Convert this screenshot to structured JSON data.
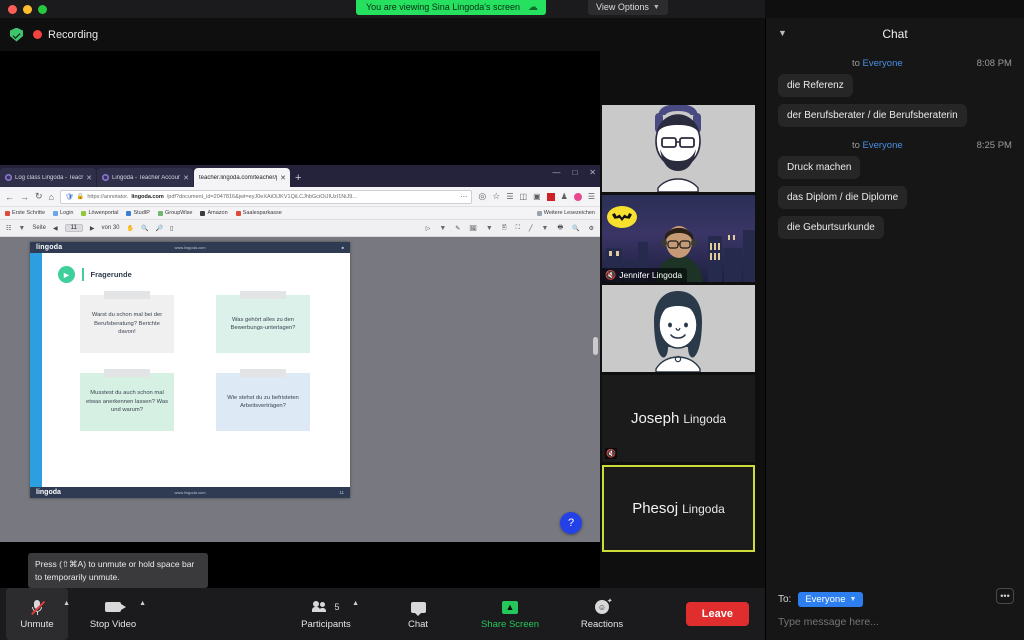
{
  "window": {
    "viewing_banner": "You are viewing Sina Lingoda's screen",
    "view_options_label": "View Options",
    "recording_label": "Recording",
    "view_button_label": "View"
  },
  "browser": {
    "tabs": [
      {
        "title": "Log class Lingoda - Teacher A…",
        "active": false
      },
      {
        "title": "Lingoda - Teacher Account",
        "active": false
      },
      {
        "title": "teacher.lingoda.com/teacher/pdf",
        "active": true
      }
    ],
    "new_tab_label": "+",
    "url_prefix": "https://annotator.",
    "url_brand": "lingoda.com",
    "url_suffix": "/pdf?document_id=2047816&jwt=eyJ0eXAiOiJKV1QiLCJhbGciOiJIUzI1NiJ9...",
    "bookmarks": [
      {
        "label": "Erste Schritte",
        "color": "#e04a3a"
      },
      {
        "label": "Login",
        "color": "#6aa5e8"
      },
      {
        "label": "Löwenportal",
        "color": "#8fc93a"
      },
      {
        "label": "StudIP",
        "color": "#3b7fd4"
      },
      {
        "label": "GroupWise",
        "color": "#6fb86f"
      },
      {
        "label": "Amazon",
        "color": "#3c3c3c"
      },
      {
        "label": "Saalesparkasse",
        "color": "#e04a3a"
      }
    ],
    "bookmarks_more": "Weitere Lesezeichen"
  },
  "pdf_toolbar": {
    "page_word": "Seite",
    "page_value": "11",
    "of_label": "von 30"
  },
  "slide": {
    "brand": "lingoda",
    "website": "www.lingoda.com",
    "page_number": "11",
    "title": "Fragerunde",
    "cards": [
      {
        "text": "Warst du schon mal bei der Berufsberatung? Berichte davon!",
        "color": "grey"
      },
      {
        "text": "Was gehört alles zu den Bewerbungs-unterlagen?",
        "color": "mint"
      },
      {
        "text": "Musstest du auch schon mal etwas anerkennen lassen? Was und warum?",
        "color": "mint2"
      },
      {
        "text": "Wie stehst du zu befristeten Arbeitsverträgen?",
        "color": "blue"
      }
    ],
    "help_icon": "?"
  },
  "participants": [
    {
      "name": "",
      "type": "avatar-beard",
      "muted": false,
      "label": ""
    },
    {
      "name": "Jennifer Lingoda",
      "type": "video",
      "muted": true,
      "label": "Jennifer Lingoda"
    },
    {
      "name": "",
      "type": "avatar-woman",
      "muted": false,
      "label": ""
    },
    {
      "name": "Joseph Lingoda",
      "first": "Joseph",
      "last": "Lingoda",
      "type": "name-only",
      "muted": true,
      "label": ""
    },
    {
      "name": "Phesoj Lingoda",
      "first": "Phesoj",
      "last": "Lingoda",
      "type": "name-only",
      "muted": false,
      "active_speaker": true,
      "label": ""
    }
  ],
  "chat": {
    "title": "Chat",
    "groups": [
      {
        "to_prefix": "to",
        "to_target": "Everyone",
        "time": "8:08 PM",
        "messages": [
          "die Referenz",
          "der Berufsberater / die Berufsberaterin"
        ]
      },
      {
        "to_prefix": "to",
        "to_target": "Everyone",
        "time": "8:25 PM",
        "messages": [
          "Druck machen",
          "das Diplom / die Diplome",
          "die Geburtsurkunde"
        ]
      }
    ],
    "to_label": "To:",
    "to_pill": "Everyone",
    "input_placeholder": "Type message here...",
    "more_icon": "•••"
  },
  "toolbar": {
    "tooltip": "Press  (⇧⌘A) to unmute or hold space bar to temporarily unmute.",
    "unmute_label": "Unmute",
    "stop_video_label": "Stop Video",
    "participants_label": "Participants",
    "participants_count": "5",
    "chat_label": "Chat",
    "share_label": "Share Screen",
    "reactions_label": "Reactions",
    "leave_label": "Leave"
  },
  "colors": {
    "green_banner": "#26e05f",
    "leave_red": "#e02d2d",
    "share_green": "#25c65c",
    "accent_blue": "#2d7ff0",
    "active_speaker": "#cddc39"
  }
}
